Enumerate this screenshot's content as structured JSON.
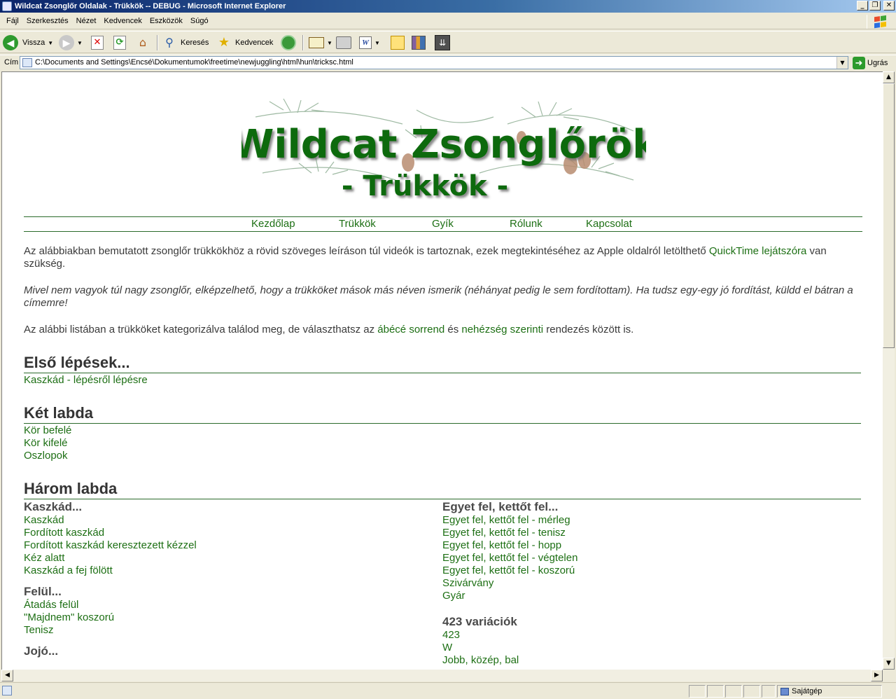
{
  "window": {
    "title": "Wildcat Zsonglőr Oldalak - Trükkök -- DEBUG - Microsoft Internet Explorer",
    "minimize": "_",
    "maximize": "❐",
    "close": "✕"
  },
  "menu": [
    "Fájl",
    "Szerkesztés",
    "Nézet",
    "Kedvencek",
    "Eszközök",
    "Súgó"
  ],
  "toolbar": {
    "back": "Vissza",
    "search": "Keresés",
    "favorites": "Kedvencek"
  },
  "address": {
    "label": "Cím",
    "url": "C:\\Documents and Settings\\Encsé\\Dokumentumok\\freetime\\newjuggling\\html\\hun\\tricksc.html",
    "go": "Ugrás"
  },
  "banner": {
    "title": "Wildcat Zsonglőrök",
    "subtitle": "- Trükkök -"
  },
  "nav": [
    "Kezdőlap",
    "Trükkök",
    "Gyík",
    "Rólunk",
    "Kapcsolat"
  ],
  "intro": {
    "p1_before": "Az alábbiakban bemutatott zsonglőr trükkökhöz a rövid szöveges leíráson túl videók is tartoznak, ezek megtekintéséhez az Apple oldalról letölthető ",
    "p1_link": "QuickTime lejátszóra",
    "p1_after": " van szükség.",
    "p2": "Mivel nem vagyok túl nagy zsonglőr, elképzelhető, hogy a trükköket mások más néven ismerik (néhányat pedig le sem fordítottam). Ha tudsz egy-egy jó fordítást, küldd el bátran a címemre!",
    "p3_before": "Az alábbi listában a trükköket kategorizálva találod meg, de választhatsz az ",
    "p3_link1": "ábécé sorrend",
    "p3_mid": " és ",
    "p3_link2": "nehézség szerinti",
    "p3_after": " rendezés között is."
  },
  "sections": {
    "first_steps": {
      "title": "Első lépések...",
      "items": [
        "Kaszkád - lépésről lépésre"
      ]
    },
    "two_balls": {
      "title": "Két labda",
      "items": [
        "Kör befelé",
        "Kör kifelé",
        "Oszlopok"
      ]
    },
    "three_balls": {
      "title": "Három labda",
      "left": {
        "cascade_title": "Kaszkád...",
        "cascade_items": [
          "Kaszkád",
          "Fordított kaszkád",
          "Fordított kaszkád keresztezett kézzel",
          "Kéz alatt",
          "Kaszkád a fej fölött"
        ],
        "over_title": "Felül...",
        "over_items": [
          "Átadás felül",
          "\"Majdnem\" koszorú",
          "Tenisz"
        ],
        "yoyo_title": "Jojó..."
      },
      "right": {
        "one_up_title": "Egyet fel, kettőt fel...",
        "one_up_items": [
          "Egyet fel, kettőt fel - mérleg",
          "Egyet fel, kettőt fel - tenisz",
          "Egyet fel, kettőt fel - hopp",
          "Egyet fel, kettőt fel - végtelen",
          "Egyet fel, kettőt fel - koszorú",
          "Szivárvány",
          "Gyár"
        ],
        "v423_title": "423 variációk",
        "v423_items": [
          "423",
          "W",
          "Jobb, közép, bal"
        ]
      }
    }
  },
  "status": {
    "zone": "Sajátgép"
  },
  "colors": {
    "link": "#1d6f14",
    "rule": "#2b6b2b",
    "title_bar": "#0a246a"
  }
}
